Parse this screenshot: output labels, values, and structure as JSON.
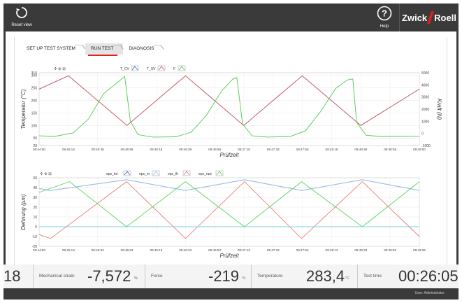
{
  "topbar": {
    "reset_label": "Reset view",
    "help_label": "Help",
    "logo_left": "Zwick",
    "logo_right": "Roell"
  },
  "breadcrumbs": [
    "SET UP TEST SYSTEM",
    "RUN TEST",
    "DIAGNOSIS"
  ],
  "chart_data": [
    {
      "type": "line",
      "xlabel": "Prüfzeit",
      "ylabel": "Temperatur (°C)",
      "y2label": "Kraft (N)",
      "x_ticks": [
        "09:44:50",
        "09:45:18",
        "09:45:38",
        "09:45:58",
        "09:46:18",
        "09:46:38",
        "09:46:58",
        "09:47:18",
        "09:47:38",
        "09:47:58",
        "09:48:18",
        "09:48:38",
        "09:48:58",
        "09:49:00"
      ],
      "ylim": [
        20,
        310
      ],
      "y_ticks": [
        20,
        50,
        100,
        150,
        200,
        250,
        300,
        310
      ],
      "y2lim": [
        -1000,
        5000
      ],
      "y2_ticks": [
        -1000,
        0,
        1000,
        2000,
        3000,
        4000,
        5000
      ],
      "legend": [
        "T_CV",
        "T_SV",
        "F"
      ],
      "series": [
        {
          "name": "T_CV",
          "color": "#3a6fc4",
          "axis": "left",
          "points": [
            [
              0,
              245
            ],
            [
              0.077,
              298
            ],
            [
              0.231,
              100
            ],
            [
              0.385,
              298
            ],
            [
              0.538,
              100
            ],
            [
              0.692,
              298
            ],
            [
              0.846,
              100
            ],
            [
              1,
              245
            ]
          ]
        },
        {
          "name": "T_SV",
          "color": "#e06060",
          "axis": "left",
          "points": [
            [
              0,
              245
            ],
            [
              0.077,
              298
            ],
            [
              0.231,
              100
            ],
            [
              0.385,
              298
            ],
            [
              0.538,
              100
            ],
            [
              0.692,
              298
            ],
            [
              0.846,
              100
            ],
            [
              1,
              245
            ]
          ]
        },
        {
          "name": "F",
          "color": "#4ecb4e",
          "axis": "right",
          "points": [
            [
              0,
              -200
            ],
            [
              0.04,
              -250
            ],
            [
              0.09,
              50
            ],
            [
              0.13,
              1200
            ],
            [
              0.17,
              3300
            ],
            [
              0.21,
              4300
            ],
            [
              0.225,
              4700
            ],
            [
              0.24,
              1000
            ],
            [
              0.26,
              -100
            ],
            [
              0.3,
              -300
            ],
            [
              0.36,
              -280
            ],
            [
              0.4,
              100
            ],
            [
              0.44,
              1500
            ],
            [
              0.48,
              3500
            ],
            [
              0.51,
              4500
            ],
            [
              0.52,
              4600
            ],
            [
              0.535,
              800
            ],
            [
              0.56,
              -200
            ],
            [
              0.6,
              -300
            ],
            [
              0.66,
              -250
            ],
            [
              0.7,
              200
            ],
            [
              0.74,
              1800
            ],
            [
              0.78,
              3700
            ],
            [
              0.81,
              4400
            ],
            [
              0.825,
              4500
            ],
            [
              0.835,
              900
            ],
            [
              0.86,
              -150
            ],
            [
              0.9,
              -250
            ],
            [
              1,
              -240
            ]
          ]
        }
      ]
    },
    {
      "type": "line",
      "xlabel": "Prüfzeit",
      "ylabel": "Dehnung (µm)",
      "x_ticks": [
        "09:44:50",
        "09:45:13",
        "09:45:33",
        "09:45:53",
        "09:46:13",
        "09:46:33",
        "09:46:53",
        "09:47:13",
        "09:47:33",
        "09:47:53",
        "09:48:13",
        "09:48:33",
        "09:48:53",
        "09:49:06"
      ],
      "ylim": [
        -20,
        50
      ],
      "y_ticks": [
        -20,
        -10,
        0,
        10,
        20,
        30,
        40,
        50
      ],
      "legend": [
        "eps_tot",
        "eps_m",
        "eps_th",
        "eps_raw"
      ],
      "series": [
        {
          "name": "eps_tot",
          "color": "#3a6fc4",
          "points": [
            [
              0,
              39
            ],
            [
              0.03,
              37
            ],
            [
              0.23,
              48
            ],
            [
              0.385,
              37
            ],
            [
              0.54,
              48
            ],
            [
              0.69,
              37
            ],
            [
              0.85,
              48
            ],
            [
              1,
              37
            ]
          ]
        },
        {
          "name": "eps_m",
          "color": "#9fc4ea",
          "points": [
            [
              0,
              39
            ],
            [
              0.03,
              37
            ],
            [
              0.23,
              48
            ],
            [
              0.385,
              37
            ],
            [
              0.54,
              48
            ],
            [
              0.69,
              37
            ],
            [
              0.85,
              48
            ],
            [
              1,
              37
            ]
          ]
        },
        {
          "name": "eps_th",
          "color": "#e87a7a",
          "points": [
            [
              0,
              -8
            ],
            [
              0.03,
              -12
            ],
            [
              0.23,
              46
            ],
            [
              0.385,
              -12
            ],
            [
              0.54,
              46
            ],
            [
              0.69,
              -12
            ],
            [
              0.85,
              46
            ],
            [
              1,
              -10
            ]
          ]
        },
        {
          "name": "eps_raw",
          "color": "#5fd45f",
          "points": [
            [
              0,
              35
            ],
            [
              0.08,
              46
            ],
            [
              0.23,
              0
            ],
            [
              0.385,
              46
            ],
            [
              0.54,
              0
            ],
            [
              0.69,
              46
            ],
            [
              0.85,
              0
            ],
            [
              1,
              46
            ]
          ]
        },
        {
          "name": "eps_zero",
          "color": "#79d0e8",
          "points": [
            [
              0,
              0
            ],
            [
              1,
              0
            ]
          ]
        }
      ]
    }
  ],
  "status": [
    {
      "label": "",
      "value": "18",
      "unit": ""
    },
    {
      "label": "Mechanical strain",
      "value": "-7,572",
      "unit": "%"
    },
    {
      "label": "Force",
      "value": "-219",
      "unit": "N"
    },
    {
      "label": "Temperature",
      "value": "283,4",
      "unit": "°C"
    },
    {
      "label": "Test time",
      "value": "00:26:05",
      "unit": ""
    }
  ],
  "footer": {
    "user": "User: Administrator"
  }
}
